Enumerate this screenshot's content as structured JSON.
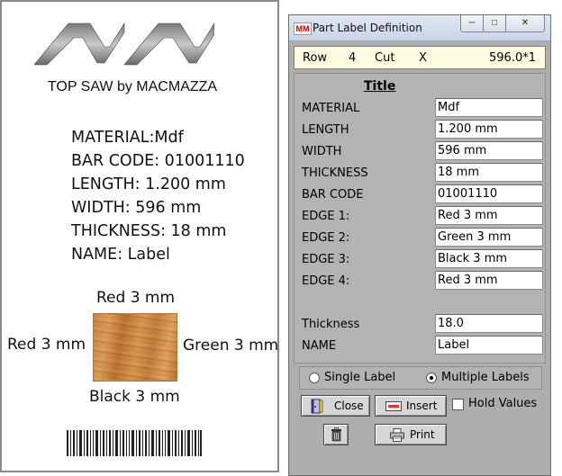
{
  "label_preview": {
    "brand": "TOP SAW by MACMAZZA",
    "lines": [
      "MATERIAL:Mdf",
      "BAR CODE: 01001110",
      "LENGTH: 1.200 mm",
      "WIDTH: 596 mm",
      "THICKNESS: 18 mm",
      "NAME: Label"
    ],
    "edges": {
      "top": "Red 3 mm",
      "left": "Red 3 mm",
      "right": "Green 3 mm",
      "bottom": "Black 3 mm"
    }
  },
  "dialog": {
    "title": "Part Label Definition",
    "window_buttons": {
      "minimize": "─",
      "maximize": "□",
      "close": "✕"
    },
    "info": {
      "row_label": "Row",
      "row_value": "4",
      "cut_label": "Cut",
      "cut_value": "X",
      "size": "596.0*1"
    },
    "form_title": "Title",
    "fields": [
      {
        "label": "MATERIAL",
        "value": "Mdf"
      },
      {
        "label": "LENGTH",
        "value": "1.200 mm"
      },
      {
        "label": "WIDTH",
        "value": "596 mm"
      },
      {
        "label": "THICKNESS",
        "value": "18 mm"
      },
      {
        "label": "BAR CODE",
        "value": "01001110"
      },
      {
        "label": "EDGE 1:",
        "value": "Red 3 mm"
      },
      {
        "label": "EDGE 2:",
        "value": "Green 3 mm"
      },
      {
        "label": "EDGE 3:",
        "value": "Black 3 mm"
      },
      {
        "label": "EDGE 4:",
        "value": "Red 3 mm"
      }
    ],
    "extra_fields": [
      {
        "label": "Thickness",
        "value": "18.0"
      },
      {
        "label": "NAME",
        "value": "Label"
      }
    ],
    "radio": {
      "single": "Single Label",
      "multiple": "Multiple Labels",
      "selected": "multiple"
    },
    "buttons": {
      "close": "Close",
      "insert": "Insert",
      "print": "Print"
    },
    "hold_values": "Hold Values"
  },
  "colors": {
    "dialog_bg": "#aeaeae",
    "info_bg": "#fffbe0"
  }
}
